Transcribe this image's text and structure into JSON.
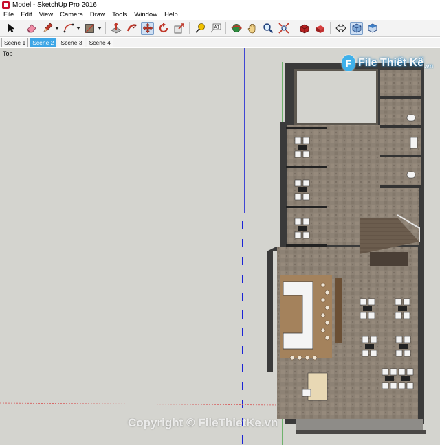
{
  "window": {
    "title": "Model - SketchUp Pro 2016"
  },
  "menu": [
    "File",
    "Edit",
    "View",
    "Camera",
    "Draw",
    "Tools",
    "Window",
    "Help"
  ],
  "toolbar": {
    "tools": [
      {
        "name": "select-icon"
      },
      {
        "name": "eraser-icon"
      },
      {
        "name": "pencil-icon"
      },
      {
        "name": "arc-icon"
      },
      {
        "name": "shape-icon"
      },
      {
        "name": "push-pull-icon"
      },
      {
        "name": "follow-me-icon"
      },
      {
        "name": "move-icon"
      },
      {
        "name": "rotate-icon"
      },
      {
        "name": "scale-icon"
      },
      {
        "name": "tape-measure-icon"
      },
      {
        "name": "text-icon"
      },
      {
        "name": "orbit-icon"
      },
      {
        "name": "pan-icon"
      },
      {
        "name": "zoom-icon"
      },
      {
        "name": "zoom-extents-icon"
      },
      {
        "name": "3d-warehouse-icon"
      },
      {
        "name": "extension-warehouse-icon"
      },
      {
        "name": "position-camera-icon"
      },
      {
        "name": "iso-view-icon"
      },
      {
        "name": "top-view-icon"
      }
    ],
    "active_tool": "move-icon",
    "accent": "#cfe0f4"
  },
  "scenes": {
    "tabs": [
      "Scene 1",
      "Scene 2",
      "Scene 3",
      "Scene 4"
    ],
    "active": 1
  },
  "viewport": {
    "view_label": "Top",
    "background": "#d4d4cf",
    "axis_colors": {
      "green": "#2d9b2d",
      "blue": "#1b23d6",
      "red": "#d65858"
    }
  },
  "watermark": {
    "brand": "File Thiết Kế",
    "domain": ".vn",
    "copyright": "Copyright © FileThietKe.vn"
  }
}
